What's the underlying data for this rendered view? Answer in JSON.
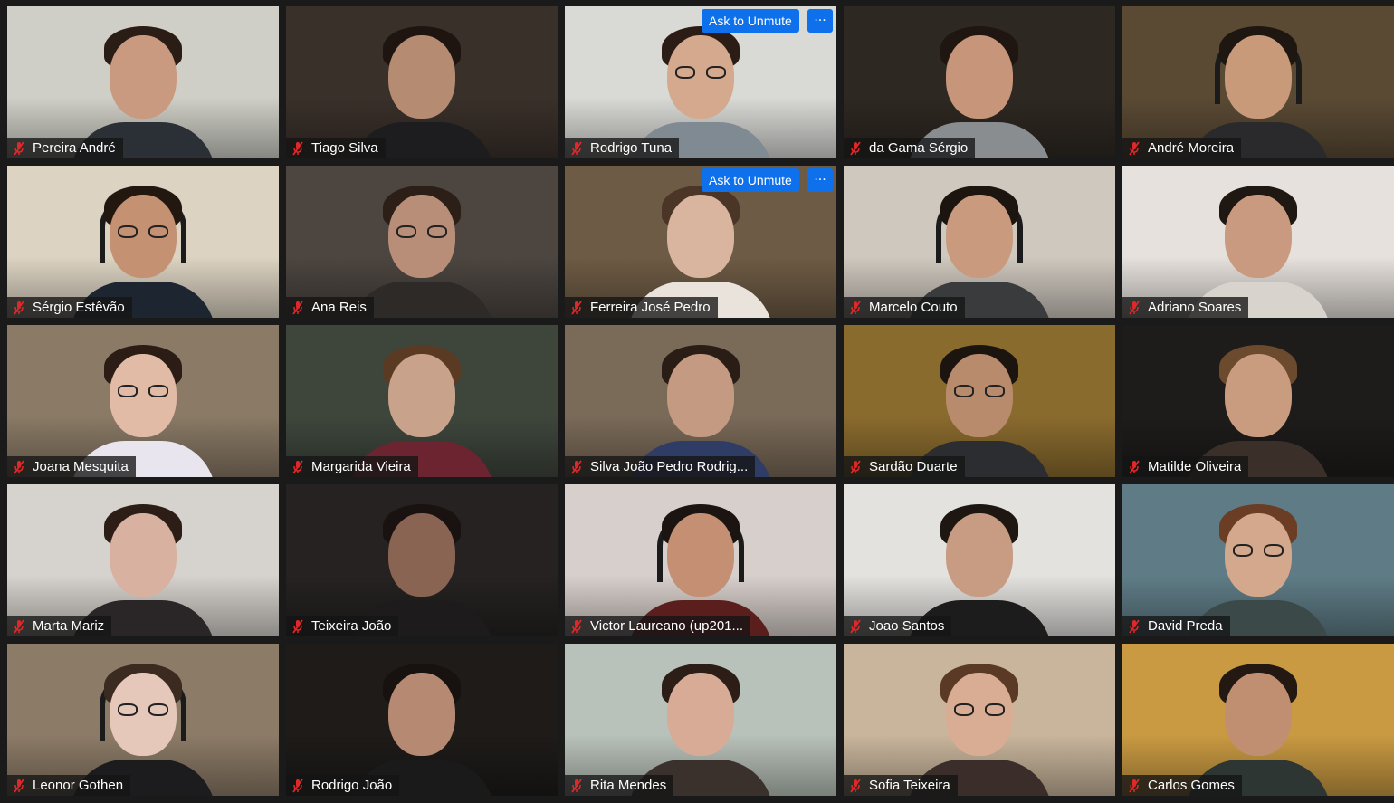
{
  "meeting": {
    "participants": [
      {
        "name": "Pereira André",
        "muted": true,
        "bg": "#cfcfc7",
        "skin": "#c99a80",
        "hair": "#2a1d16",
        "shirt": "#2b2f36"
      },
      {
        "name": "Tiago Silva",
        "muted": true,
        "bg": "#3a302a",
        "skin": "#b58b72",
        "hair": "#1e1510",
        "shirt": "#1d1d1f"
      },
      {
        "name": "Rodrigo Tuna",
        "muted": true,
        "bg": "#d9dad6",
        "skin": "#d4a98e",
        "hair": "#2b1d15",
        "shirt": "#7f8a93",
        "glasses": true,
        "ask_to_unmute": true
      },
      {
        "name": "da Gama Sérgio",
        "muted": true,
        "bg": "#2e2822",
        "skin": "#c79579",
        "hair": "#1f1611",
        "shirt": "#8a8d90"
      },
      {
        "name": "André Moreira",
        "muted": true,
        "bg": "#5a4a34",
        "skin": "#c89a7a",
        "hair": "#1e1610",
        "shirt": "#2a2a2d",
        "headset": true
      },
      {
        "name": "Sérgio Estêvão",
        "muted": true,
        "bg": "#dcd3c2",
        "skin": "#c49173",
        "hair": "#22180f",
        "shirt": "#1c2530",
        "glasses": true,
        "headset": true
      },
      {
        "name": "Ana Reis",
        "muted": true,
        "bg": "#4c4540",
        "skin": "#b88e78",
        "hair": "#2b1f17",
        "shirt": "#2d2a28",
        "glasses": true
      },
      {
        "name": "Ferreira José Pedro",
        "muted": true,
        "bg": "#6e5b45",
        "skin": "#d9b59f",
        "hair": "#4a3526",
        "shirt": "#e9e3dc",
        "ask_to_unmute": true
      },
      {
        "name": "Marcelo Couto",
        "muted": true,
        "bg": "#cfc8bf",
        "skin": "#c99a7e",
        "hair": "#1c140e",
        "shirt": "#3a3b3d",
        "headset": true
      },
      {
        "name": "Adriano Soares",
        "muted": true,
        "bg": "#e6e1dc",
        "skin": "#c99a80",
        "hair": "#1f1712",
        "shirt": "#d8d3cc"
      },
      {
        "name": "Joana Mesquita",
        "muted": true,
        "bg": "#8a7a66",
        "skin": "#e1bba6",
        "hair": "#2b1d16",
        "shirt": "#e9e5ef",
        "glasses": true
      },
      {
        "name": "Margarida Vieira",
        "muted": true,
        "bg": "#3e463c",
        "skin": "#c8a28a",
        "hair": "#5a3a22",
        "shirt": "#6b2430"
      },
      {
        "name": "Silva João Pedro Rodrig...",
        "muted": true,
        "bg": "#7a6a58",
        "skin": "#c49a82",
        "hair": "#2a1d15",
        "shirt": "#2f3d66"
      },
      {
        "name": "Sardão Duarte",
        "muted": true,
        "bg": "#8a6b2e",
        "skin": "#b98b6d",
        "hair": "#1b140f",
        "shirt": "#2c2d30",
        "glasses": true
      },
      {
        "name": "Matilde Oliveira",
        "muted": true,
        "bg": "#1e1c1b",
        "skin": "#c99b7f",
        "hair": "#6b4a2e",
        "shirt": "#3a2f29"
      },
      {
        "name": "Marta Mariz",
        "muted": true,
        "bg": "#d6d2cd",
        "skin": "#d8b1a0",
        "hair": "#2c1e17",
        "shirt": "#2a2526"
      },
      {
        "name": "Teixeira João",
        "muted": true,
        "bg": "#252221",
        "skin": "#8a6452",
        "hair": "#1a1210",
        "shirt": "#1d1b1b"
      },
      {
        "name": "Victor Laureano (up201...",
        "muted": true,
        "bg": "#d7cfcb",
        "skin": "#c48f72",
        "hair": "#1b1410",
        "shirt": "#5a1f1c",
        "headset": true
      },
      {
        "name": "Joao Santos",
        "muted": true,
        "bg": "#e3e2df",
        "skin": "#c89c82",
        "hair": "#1d1611",
        "shirt": "#1d1c1c"
      },
      {
        "name": "David Preda",
        "muted": true,
        "bg": "#5f7c86",
        "skin": "#d3a88d",
        "hair": "#6b3d24",
        "shirt": "#3b4a48",
        "glasses": true
      },
      {
        "name": "Leonor Gothen",
        "muted": true,
        "bg": "#8c7b67",
        "skin": "#e6c8bb",
        "hair": "#3a2a20",
        "shirt": "#1c1b1e",
        "glasses": true,
        "headset": true
      },
      {
        "name": "Rodrigo João",
        "muted": true,
        "bg": "#1e1b19",
        "skin": "#b68a72",
        "hair": "#171210",
        "shirt": "#1a1a1b"
      },
      {
        "name": "Rita Mendes",
        "muted": true,
        "bg": "#b9c2ba",
        "skin": "#d7ab95",
        "hair": "#2c1d17",
        "shirt": "#3a302c"
      },
      {
        "name": "Sofia Teixeira",
        "muted": true,
        "bg": "#c9b59c",
        "skin": "#d8ad94",
        "hair": "#5a3a24",
        "shirt": "#3a2d2a",
        "glasses": true
      },
      {
        "name": "Carlos Gomes",
        "muted": true,
        "bg": "#c99a42",
        "skin": "#c08f72",
        "hair": "#231912",
        "shirt": "#2e3633"
      }
    ],
    "ask_to_unmute_label": "Ask to Unmute",
    "more_options_label": "···"
  }
}
